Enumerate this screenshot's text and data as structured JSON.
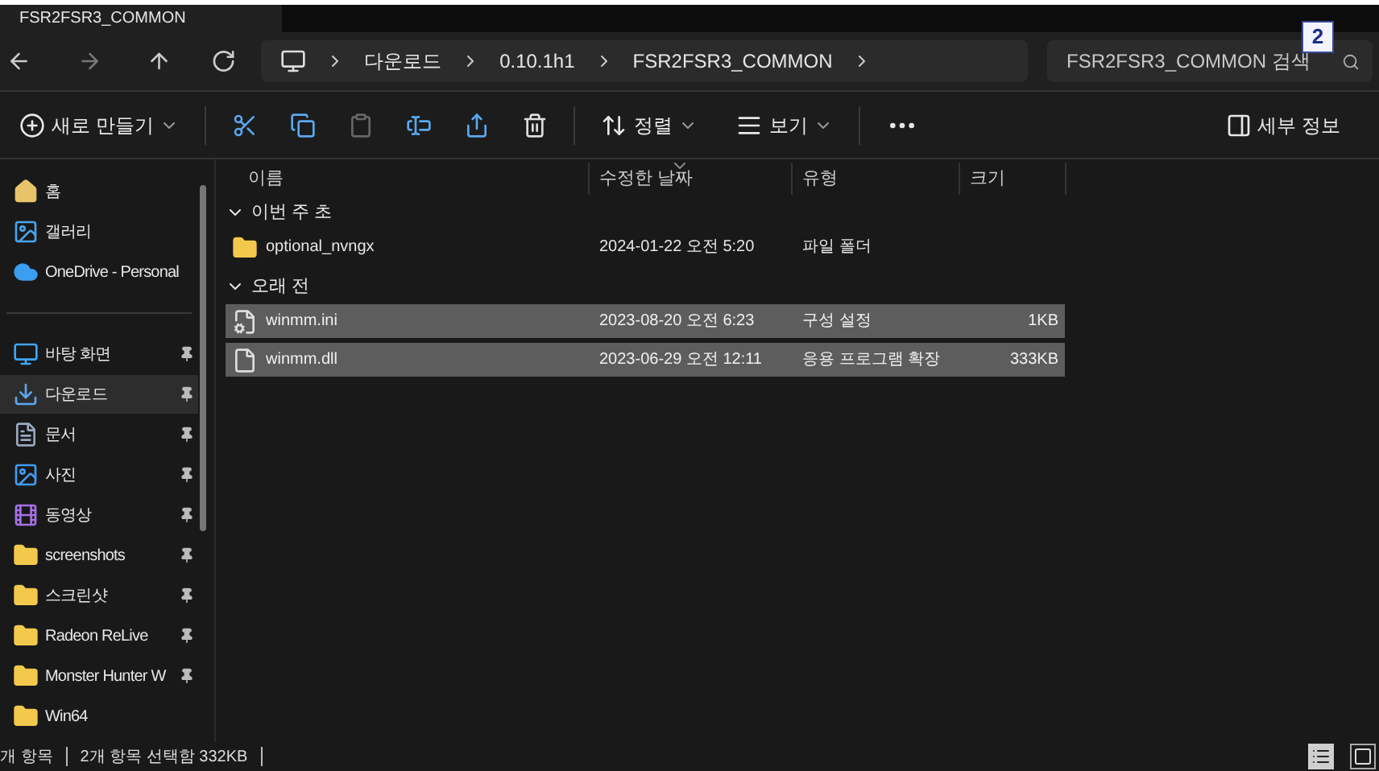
{
  "tab": {
    "title": "FSR2FSR3_COMMON"
  },
  "nav": {
    "path": [
      {
        "label": "다운로드"
      },
      {
        "label": "0.10.1h1"
      },
      {
        "label": "FSR2FSR3_COMMON"
      }
    ],
    "search_placeholder": "FSR2FSR3_COMMON 검색",
    "badge": "2"
  },
  "toolbar": {
    "new": "새로 만들기",
    "sort": "정렬",
    "view": "보기",
    "details": "세부 정보"
  },
  "sidebar": {
    "items": [
      {
        "label": "홈",
        "kind": "home",
        "pinned": false,
        "selected": false
      },
      {
        "label": "갤러리",
        "kind": "gallery",
        "pinned": false,
        "selected": false
      },
      {
        "label": "OneDrive - Personal",
        "kind": "cloud",
        "pinned": false,
        "selected": false
      },
      {
        "kind": "divider"
      },
      {
        "label": "바탕 화면",
        "kind": "desktop",
        "pinned": true,
        "selected": false
      },
      {
        "label": "다운로드",
        "kind": "download",
        "pinned": true,
        "selected": true
      },
      {
        "label": "문서",
        "kind": "docs",
        "pinned": true,
        "selected": false
      },
      {
        "label": "사진",
        "kind": "photo",
        "pinned": true,
        "selected": false
      },
      {
        "label": "동영상",
        "kind": "video",
        "pinned": true,
        "selected": false
      },
      {
        "label": "screenshots",
        "kind": "folder",
        "pinned": true,
        "selected": false
      },
      {
        "label": "스크린샷",
        "kind": "folder",
        "pinned": true,
        "selected": false
      },
      {
        "label": "Radeon ReLive",
        "kind": "folder",
        "pinned": true,
        "selected": false
      },
      {
        "label": "Monster Hunter W",
        "kind": "folder",
        "pinned": true,
        "selected": false
      },
      {
        "label": "Win64",
        "kind": "folder",
        "pinned": false,
        "selected": false
      }
    ]
  },
  "columns": [
    {
      "label": "이름",
      "sorted": false
    },
    {
      "label": "수정한 날짜",
      "sorted": true
    },
    {
      "label": "유형",
      "sorted": false
    },
    {
      "label": "크기",
      "sorted": false
    }
  ],
  "groups": [
    {
      "label": "이번 주 초",
      "expanded": true,
      "rows": [
        {
          "name": "optional_nvngx",
          "date": "2024-01-22 오전 5:20",
          "type": "파일 폴더",
          "size": "",
          "kind": "folder",
          "selected": false
        }
      ]
    },
    {
      "label": "오래 전",
      "expanded": true,
      "rows": [
        {
          "name": "winmm.ini",
          "date": "2023-08-20 오전 6:23",
          "type": "구성 설정",
          "size": "1KB",
          "kind": "settings",
          "selected": true
        },
        {
          "name": "winmm.dll",
          "date": "2023-06-29 오전 12:11",
          "type": "응용 프로그램 확장",
          "size": "333KB",
          "kind": "dll",
          "selected": true
        }
      ]
    }
  ],
  "status": {
    "count": "개 항목",
    "selection": "2개 항목 선택함 332KB",
    "views": [
      {
        "kind": "details",
        "selected": true
      },
      {
        "kind": "tiles",
        "selected": false
      }
    ]
  }
}
